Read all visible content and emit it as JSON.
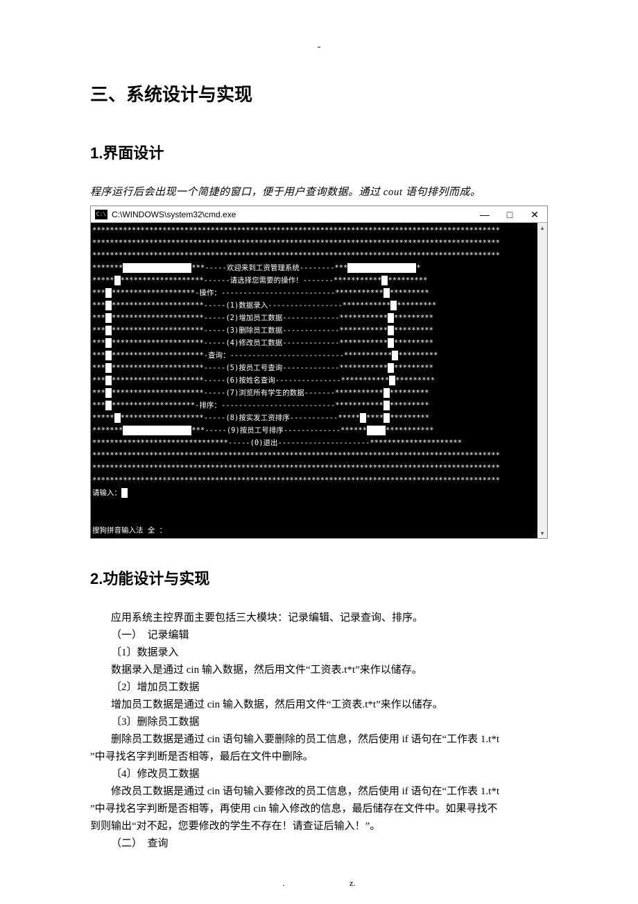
{
  "doc": {
    "top_dash": "-",
    "heading1": "三、系统设计与实现",
    "section1": "1.界面设计",
    "intro": "程序运行后会出现一个简捷的窗口，便于用户查询数据。通过 cout 语句排列而成。",
    "section2": "2.功能设计与实现",
    "footer_dot": ".",
    "footer_z": "z."
  },
  "cmd": {
    "title": "C:\\WINDOWS\\system32\\cmd.exe",
    "icon_text": "C:\\",
    "min": "—",
    "max": "□",
    "close": "✕",
    "scroll_up": "▴",
    "scroll_down": "▾",
    "lines": [
      "*********************************************************************************************",
      "*********************************************************************************************",
      "*********************************************************************************************",
      "*******▮▮▮▮▮▮▮▮▮▮▮***-----欢迎来到工资管理系统--------***▮▮▮▮▮▮▮▮▮▮▮*",
      "*****▮*******************------请选择您需要的操作！-------***********▮*********",
      "***▮*******************-操作：--------------------------***********▮*********",
      "***▮*********************-----(1)数据录入-----------------***********▮*********",
      "***▮*********************-----(2)增加员工数据-------------***********▮*********",
      "***▮*********************-----(3)删除员工数据-------------***********▮*********",
      "***▮*********************-----(4)修改员工数据-------------***********▮*********",
      "***▮*********************-查询：--------------------------***********▮*********",
      "***▮*********************-----(5)按员工号查询-------------***********▮*********",
      "***▮*********************-----(6)按姓名查询---------------***********▮*********",
      "***▮*********************-----(7)浏览所有学生的数据-------***********▮*********",
      "***▮*******************-排序：--------------------------***********▮*********",
      "*****▮*******************-----(8)按实发工资排序-----------*****▮****▮*********",
      "*******▮▮▮▮▮▮▮▮▮▮▮***-----(9)按员工号排序-------------******▮▮▮***********",
      "*******************************-----(0)退出---------------------*********************",
      "*********************************************************************************************",
      "*********************************************************************************************",
      "*********************************************************************************************",
      "请输入：▮",
      "",
      "",
      "搜狗拼音输入法 全 ："
    ]
  },
  "body": {
    "p1": "应用系统主控界面主要包括三大模块：记录编辑、记录查询、排序。",
    "p2": "（一）　记录编辑",
    "p3": "〔1〕数据录入",
    "p4": "数据录入是通过 cin 输入数据，然后用文件“工资表.t*t”来作以储存。",
    "p5": "〔2〕增加员工数据",
    "p6": "增加员工数据是通过 cin 输入数据，然后用文件“工资表.t*t”来作以储存。",
    "p7": "〔3〕删除员工数据",
    "p8a": "删除员工数据是通过 cin 语句输入要删除的员工信息，然后使用 if 语句在“工作表 1.t*t",
    "p8b": "”中寻找名字判断是否相等，最后在文件中删除。",
    "p9": "〔4〕修改员工数据",
    "p10a": "修改员工数据是通过 cin 语句输入要修改的员工信息，然后使用 if 语句在“工作表 1.t*t",
    "p10b": "”中寻找名字判断是否相等，再使用 cin 输入修改的信息，最后储存在文件中。如果寻找不",
    "p10c": "到则输出“对不起，您要修改的学生不存在！请查证后输入！”。",
    "p11": "（二）　查询"
  }
}
